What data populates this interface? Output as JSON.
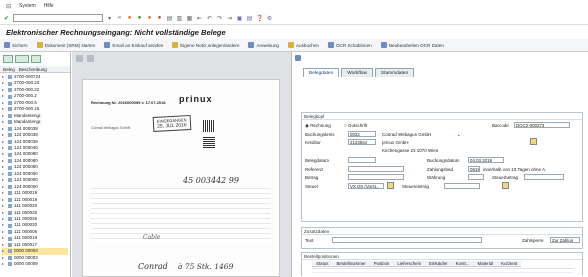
{
  "menubar": {
    "items": [
      "System",
      "Hilfe"
    ]
  },
  "title": "Elektronischer Rechnungseingang: Nicht vollständige Belege",
  "toolbar": [
    {
      "label": "Sichern",
      "icon": "save-icon"
    },
    {
      "label": "Dokument (SRM) starten",
      "icon": "document-icon"
    },
    {
      "label": "Email an Einkauf senden",
      "icon": "email-icon"
    },
    {
      "label": "Eigene Notiz anlegen/ändern",
      "icon": "note-icon"
    },
    {
      "label": "Anweisung",
      "icon": "instruction-icon"
    },
    {
      "label": "Ausbuchen",
      "icon": "post-icon"
    },
    {
      "label": "OCR Schablonen",
      "icon": "ocr-icon"
    },
    {
      "label": "Neubearbeiten OCR Daten",
      "icon": "refresh-icon"
    }
  ],
  "left": {
    "columns": [
      "Beleg",
      "Beschreibung"
    ],
    "items": [
      "2700-000724",
      "2700-000.23",
      "2700-000.22",
      "2700-000.2",
      "2700-000.5",
      "2700-000.15",
      "Mandantengr.",
      "Mandantengr.",
      "124 000038",
      "124 000039",
      "124 000039",
      "124 000040",
      "124 000080",
      "124 000080",
      "124 000080",
      "124 000000",
      "124 000000",
      "124 000000",
      "111 000019",
      "111 000019",
      "111 000020",
      "111 000025",
      "111 000026",
      "111 000020",
      "111 000006",
      "111 000019",
      "111 000017",
      "0000 00003",
      "0000 00003",
      "0000 00009"
    ]
  },
  "doc": {
    "header": "prinux",
    "invoice_no": "Rechnung Nr. 2016000095 v. 17.07.2016",
    "stamp_top": "EINGEGANGEN",
    "stamp_date": "25. JUL 2016",
    "handwriting1": "45 003442 99",
    "handwriting2": "Conrad",
    "handwriting3": "à 75 Stk. 1469",
    "handwriting4": "Cable",
    "sender": "Conrad Webagus GmbH"
  },
  "right": {
    "tabs": [
      "Belegdaten",
      "Workflow",
      "Stammdaten"
    ],
    "beleg_section": "Belegkopf",
    "radio_rechnung": "Rechnung",
    "radio_gutschrift": "Gutschrift",
    "barcode_label": "Barcode",
    "barcode_value": "DOC2-000273",
    "buchungskreis_label": "Buchungskreis",
    "buchungskreis_value": "0032",
    "buchungskreis_text": "Conrad Webagus GmbH",
    "kreditor_label": "Kreditor",
    "kreditor_value": "2123564",
    "kreditor_text": "prinux GmbH",
    "kreditor_address": "Kirchengasse 23 1070 Wien",
    "belegdatum_label": "Belegdatum",
    "buchungsdatum_label": "Buchungsdatum",
    "buchungsdatum_value": "04.03.2019",
    "referenz_label": "Referenz",
    "zahlungsbed_label": "Zahlungsbed.",
    "zahlungsbed_value": "0619",
    "zahlungsbed_text": "innerhalb von 10 Tagen ohne A.",
    "betrag_label": "Betrag",
    "waehrung_label": "Währung",
    "steuerbetrag_label": "Steuerbetrag",
    "steuer_label": "Steuer",
    "steuer_value": "VX DS (Vorst...",
    "steuereintrag_label": "Steuereintrag",
    "zusatzdaten_section": "Zusatzdaten",
    "text_label": "Text",
    "zahlsperre_label": "Zahlsperre",
    "zahlsperre_value": "Zur Zahlun",
    "bestellposition_section": "Bestellpositionen",
    "table_columns": [
      "Status",
      "Bestellnummer",
      "Position",
      "Lieferschein",
      "Einkäufer",
      "Kontr...",
      "Material",
      "Kurztext"
    ],
    "weitere_label": "Weitere Einkaufsbelege"
  }
}
